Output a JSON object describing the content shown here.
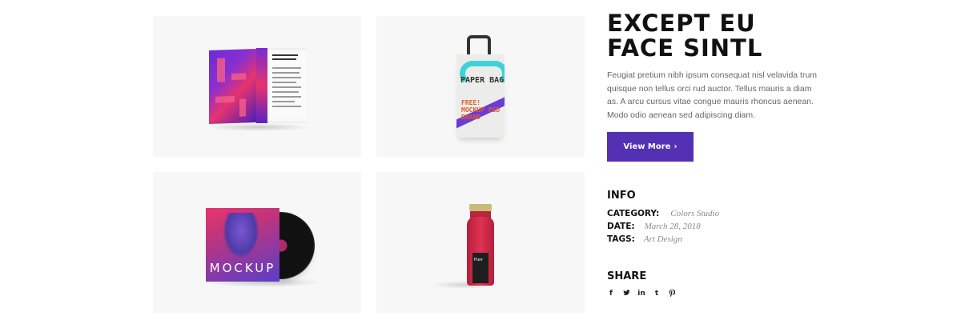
{
  "project": {
    "title_line1": "EXCEPT EU",
    "title_line2": "FACE SINTL",
    "description": "Feugiat pretium nibh ipsum consequat nisl velavida trum quisque non tellus orci rud auctor. Tellus mauris a diam as. A arcu cursus vitae congue mauris rhoncus aenean. Modo odio aenean sed adipiscing diam.",
    "button_label": "View More",
    "button_icon": "chevron-right-icon"
  },
  "info": {
    "heading": "INFO",
    "rows": [
      {
        "key": "CATEGORY:",
        "value": "Colors Studio"
      },
      {
        "key": "DATE:",
        "value": "March 28, 2018"
      },
      {
        "key": "TAGS:",
        "value": "Art Design"
      }
    ]
  },
  "share": {
    "heading": "SHARE",
    "icons": [
      {
        "name": "facebook-icon",
        "glyph": "f"
      },
      {
        "name": "twitter-icon",
        "glyph": "🐦"
      },
      {
        "name": "linkedin-icon",
        "glyph": "in"
      },
      {
        "name": "tumblr-icon",
        "glyph": "t"
      },
      {
        "name": "pinterest-icon",
        "glyph": "℗"
      }
    ]
  },
  "gallery": {
    "bag_text": "PAPER BAG",
    "bag_subtext": "FREE! MOCKUP PSD BRAND",
    "album_text": "MOCKUP",
    "bottle_label": "Pure"
  },
  "colors": {
    "accent": "#5431b4",
    "tile_bg": "#f7f7f7"
  }
}
